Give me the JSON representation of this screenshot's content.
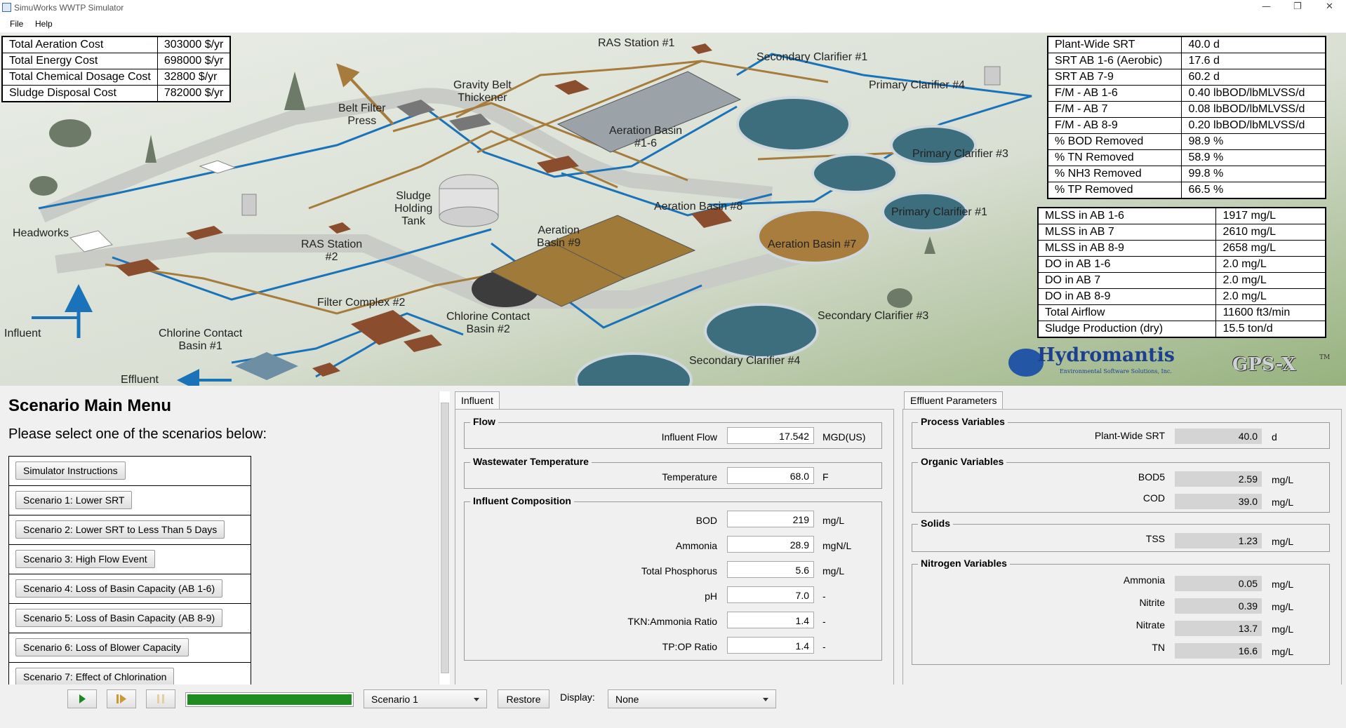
{
  "window": {
    "title": "SimuWorks WWTP Simulator",
    "minimize": "—",
    "restore": "❐",
    "close": "✕"
  },
  "menu": {
    "file": "File",
    "help": "Help"
  },
  "cost_table": [
    {
      "label": "Total Aeration Cost",
      "value": "303000 $/yr"
    },
    {
      "label": "Total Energy Cost",
      "value": "698000 $/yr"
    },
    {
      "label": "Total Chemical Dosage Cost",
      "value": "32800 $/yr"
    },
    {
      "label": "Sludge Disposal Cost",
      "value": "782000 $/yr"
    }
  ],
  "srt_table": [
    {
      "label": "Plant-Wide SRT",
      "value": "40.0 d"
    },
    {
      "label": "SRT AB 1-6 (Aerobic)",
      "value": "17.6 d"
    },
    {
      "label": "SRT AB 7-9",
      "value": "60.2 d"
    },
    {
      "label": "F/M - AB 1-6",
      "value": "0.40 lbBOD/lbMLVSS/d"
    },
    {
      "label": "F/M - AB 7",
      "value": "0.08 lbBOD/lbMLVSS/d"
    },
    {
      "label": "F/M - AB 8-9",
      "value": "0.20 lbBOD/lbMLVSS/d"
    },
    {
      "label": "% BOD Removed",
      "value": "98.9 %"
    },
    {
      "label": "% TN Removed",
      "value": "58.9 %"
    },
    {
      "label": "% NH3 Removed",
      "value": "99.8 %"
    },
    {
      "label": "% TP Removed",
      "value": "66.5 %"
    }
  ],
  "mlss_table": [
    {
      "label": "MLSS in AB 1-6",
      "value": "1917 mg/L"
    },
    {
      "label": "MLSS in AB 7",
      "value": "2610 mg/L"
    },
    {
      "label": "MLSS in AB 8-9",
      "value": "2658 mg/L"
    },
    {
      "label": "DO in AB 1-6",
      "value": "2.0 mg/L"
    },
    {
      "label": "DO in AB 7",
      "value": "2.0 mg/L"
    },
    {
      "label": "DO in AB 8-9",
      "value": "2.0 mg/L"
    },
    {
      "label": "Total Airflow",
      "value": "11600 ft3/min"
    },
    {
      "label": "Sludge Production (dry)",
      "value": "15.5 ton/d"
    }
  ],
  "schematic_labels": {
    "ras1": "RAS Station #1",
    "sec1": "Secondary Clarifier #1",
    "gbt": "Gravity Belt\nThickener",
    "prim4": "Primary Clarifier #4",
    "bfp": "Belt Filter\nPress",
    "ab16": "Aeration Basin\n#1-6",
    "prim3": "Primary Clarifier #3",
    "sht": "Sludge\nHolding\nTank",
    "ab8": "Aeration Basin #8",
    "prim1": "Primary Clarifier #1",
    "headworks": "Headworks",
    "ras2": "RAS Station\n#2",
    "ab9": "Aeration\nBasin #9",
    "ab7": "Aeration Basin #7",
    "fc2": "Filter Complex #2",
    "ccb2": "Chlorine Contact\nBasin #2",
    "sec3": "Secondary Clarifier #3",
    "influent": "Influent",
    "ccb1": "Chlorine Contact\nBasin #1",
    "sec4": "Secondary Clarifier #4",
    "effluent": "Effluent"
  },
  "logos": {
    "hydromantis": "Hydromantis",
    "hydro_sub": "Environmental Software Solutions, Inc.",
    "gpsx": "GPS-X",
    "tm": "TM"
  },
  "scenario": {
    "title": "Scenario Main Menu",
    "subtitle": "Please select one of the scenarios below:",
    "buttons": [
      "Simulator Instructions",
      "Scenario 1: Lower SRT",
      "Scenario 2: Lower SRT to Less Than 5 Days",
      "Scenario 3: High Flow Event",
      "Scenario 4: Loss of Basin Capacity (AB 1-6)",
      "Scenario 5: Loss of Basin Capacity (AB 8-9)",
      "Scenario 6: Loss of Blower Capacity",
      "Scenario 7: Effect of Chlorination"
    ]
  },
  "influent": {
    "tab": "Influent",
    "flow_group": "Flow",
    "flow_label": "Influent Flow",
    "flow_value": "17.542",
    "flow_unit": "MGD(US)",
    "temp_group": "Wastewater Temperature",
    "temp_label": "Temperature",
    "temp_value": "68.0",
    "temp_unit": "F",
    "comp_group": "Influent Composition",
    "comp": [
      {
        "label": "BOD",
        "value": "219",
        "unit": "mg/L"
      },
      {
        "label": "Ammonia",
        "value": "28.9",
        "unit": "mgN/L"
      },
      {
        "label": "Total Phosphorus",
        "value": "5.6",
        "unit": "mg/L"
      },
      {
        "label": "pH",
        "value": "7.0",
        "unit": "-"
      },
      {
        "label": "TKN:Ammonia Ratio",
        "value": "1.4",
        "unit": "-"
      },
      {
        "label": "TP:OP Ratio",
        "value": "1.4",
        "unit": "-"
      }
    ]
  },
  "effluent": {
    "tab": "Effluent Parameters",
    "proc_group": "Process Variables",
    "srt_label": "Plant-Wide SRT",
    "srt_value": "40.0",
    "srt_unit": "d",
    "org_group": "Organic Variables",
    "bod_label": "BOD5",
    "bod_value": "2.59",
    "bod_unit": "mg/L",
    "cod_label": "COD",
    "cod_value": "39.0",
    "cod_unit": "mg/L",
    "sol_group": "Solids",
    "tss_label": "TSS",
    "tss_value": "1.23",
    "tss_unit": "mg/L",
    "n_group": "Nitrogen Variables",
    "nh_label": "Ammonia",
    "nh_value": "0.05",
    "nh_unit": "mg/L",
    "no2_label": "Nitrite",
    "no2_value": "0.39",
    "no2_unit": "mg/L",
    "no3_label": "Nitrate",
    "no3_value": "13.7",
    "no3_unit": "mg/L",
    "tn_label": "TN",
    "tn_value": "16.6",
    "tn_unit": "mg/L"
  },
  "controls": {
    "progress": 1.0,
    "scenario_select": "Scenario 1",
    "restore": "Restore",
    "display_label": "Display:",
    "display_select": "None"
  },
  "colors": {
    "pipe_blue": "#1a73b8",
    "pipe_brown": "#a67c3d",
    "clarifier": "#3d6e7e",
    "progress_green": "#1e8c1e"
  }
}
